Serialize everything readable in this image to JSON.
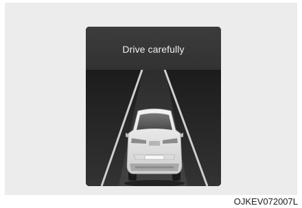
{
  "display": {
    "message": "Drive carefully"
  },
  "caption": "OJKEV072007L",
  "colors": {
    "panel_background": "#ececec",
    "display_background": "#2a2a2a",
    "header_background": "#363636",
    "lane_line": "#d0d0d0",
    "car_body": "#e8e8e8"
  },
  "icons": {
    "vehicle": "car-rear-view-icon",
    "road": "lane-lines-icon"
  }
}
